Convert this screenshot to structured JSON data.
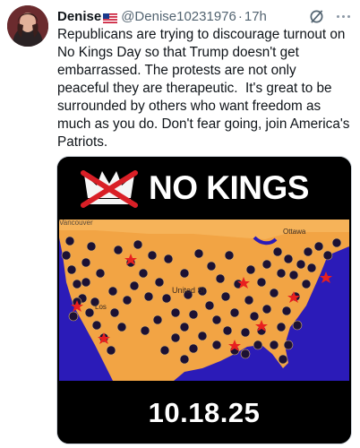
{
  "tweet": {
    "display_name": "Denise",
    "flag_icon": "us-flag-icon",
    "handle": "@Denise10231976",
    "separator": "·",
    "time": "17h",
    "text": "Republicans are trying to discourage turnout on\nNo Kings Day so that Trump doesn't get\nembarrassed. The protests are not only\npeaceful they are therapeutic.  It's great to be\nsurrounded by others who want freedom as\nmuch as you do. Don't fear going, join America's\nPatriots."
  },
  "media": {
    "headline": "NO KINGS",
    "date": "10.18.25",
    "map_labels": {
      "top_left": "Vancouver",
      "center": "United St",
      "left": "Los",
      "top_right": "Ottawa"
    },
    "colors": {
      "land": "#f2a444",
      "water": "#2b1bb8",
      "dot": "#1c1133",
      "star": "#e81f1f",
      "crown": "#f5f5f5",
      "cross": "#d91f26"
    }
  }
}
